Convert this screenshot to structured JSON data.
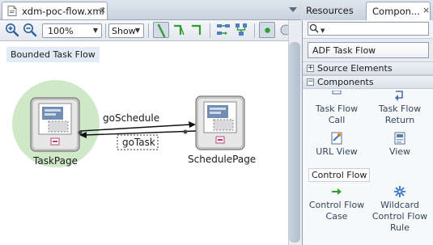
{
  "editor": {
    "tab_title": "xdm-poc-flow.xml",
    "tab_close": "×",
    "zoom_value": "100%",
    "show_label": "Show",
    "bounded_label": "Bounded Task Flow"
  },
  "diagram": {
    "nodes": [
      {
        "label": "TaskPage",
        "is_default": true
      },
      {
        "label": "SchedulePage",
        "is_default": false
      }
    ],
    "edges": [
      {
        "label": "goSchedule",
        "from": "TaskPage",
        "to": "SchedulePage"
      },
      {
        "label": "goTask",
        "from": "SchedulePage",
        "to": "TaskPage"
      }
    ]
  },
  "right": {
    "tab_resources": "Resources",
    "tab_components": "Compon...",
    "tab_close": "×",
    "search_value": "",
    "palette_selected": "ADF Task Flow",
    "sections": [
      {
        "label": "Source Elements",
        "toggle": "+"
      },
      {
        "label": "Components",
        "toggle": "−"
      }
    ],
    "components": [
      {
        "label_1": "Task Flow",
        "label_2": "Call",
        "icon": "task-flow-call-icon"
      },
      {
        "label_1": "Task Flow",
        "label_2": "Return",
        "icon": "task-flow-return-icon"
      },
      {
        "label_1": "URL View",
        "label_2": "",
        "icon": "url-view-icon"
      },
      {
        "label_1": "View",
        "label_2": "",
        "icon": "view-icon"
      }
    ],
    "control_flow_label": "Control Flow",
    "control_flow_items": [
      {
        "label_1": "Control Flow",
        "label_2": "Case",
        "icon": "control-flow-case-icon"
      },
      {
        "label_1": "Wildcard",
        "label_2": "Control Flow",
        "label_3": "Rule",
        "icon": "wildcard-icon"
      }
    ]
  },
  "colors": {
    "selection_halo": "#cfe9c8",
    "panel_bg": "#e8ecf1",
    "accent_green": "#2e9e2e",
    "link_text": "#33475c"
  }
}
